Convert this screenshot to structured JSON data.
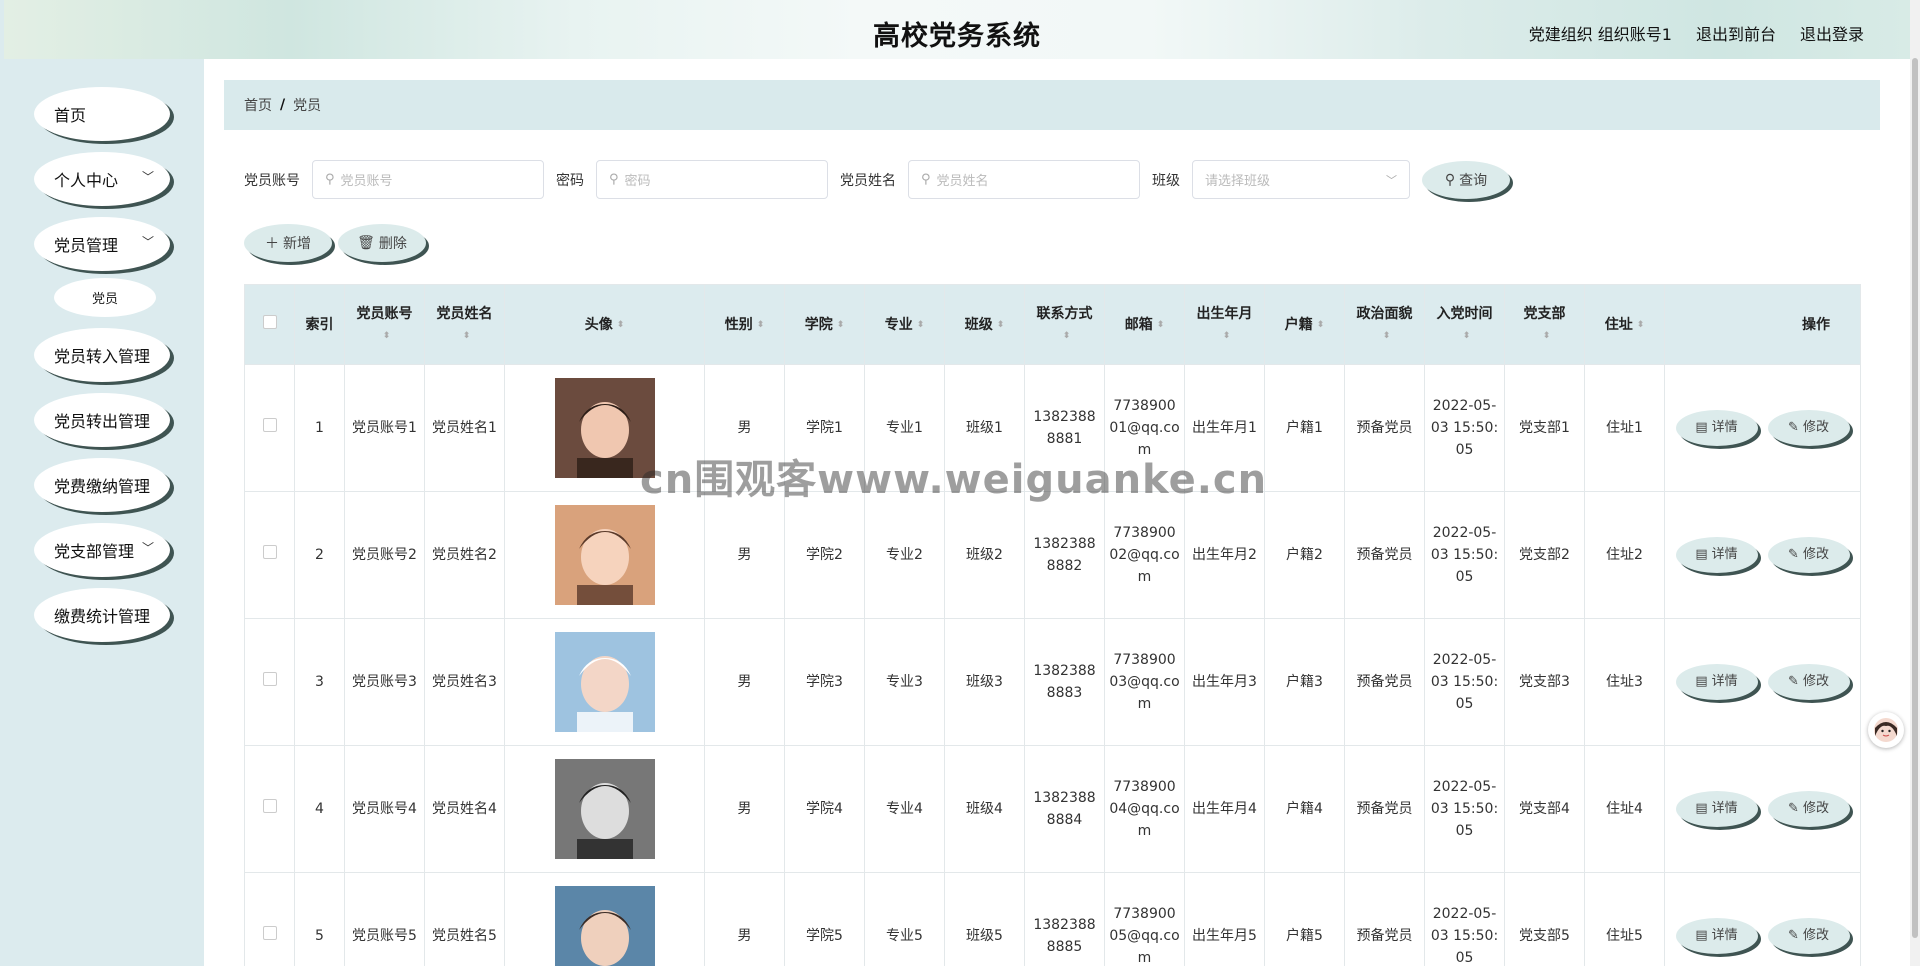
{
  "header": {
    "title": "高校党务系统",
    "user_label": "党建组织 组织账号1",
    "front_link": "退出到前台",
    "logout_link": "退出登录"
  },
  "sidebar": {
    "items": [
      {
        "label": "首页",
        "expandable": false
      },
      {
        "label": "个人中心",
        "expandable": true
      },
      {
        "label": "党员管理",
        "expandable": true
      },
      {
        "label": "党员",
        "sub": true
      },
      {
        "label": "党员转入管理",
        "expandable": false
      },
      {
        "label": "党员转出管理",
        "expandable": false
      },
      {
        "label": "党费缴纳管理",
        "expandable": false
      },
      {
        "label": "党支部管理",
        "expandable": true
      },
      {
        "label": "缴费统计管理",
        "expandable": false
      }
    ]
  },
  "breadcrumb": {
    "home": "首页",
    "sep": "/",
    "current": "党员"
  },
  "search": {
    "account_label": "党员账号",
    "account_placeholder": "党员账号",
    "password_label": "密码",
    "password_placeholder": "密码",
    "name_label": "党员姓名",
    "name_placeholder": "党员姓名",
    "class_label": "班级",
    "class_placeholder": "请选择班级",
    "query_button": "查询"
  },
  "toolbar": {
    "add_button": "新增",
    "delete_button": "删除"
  },
  "table": {
    "headers": [
      "索引",
      "党员账号",
      "党员姓名",
      "头像",
      "性别",
      "学院",
      "专业",
      "班级",
      "联系方式",
      "邮箱",
      "出生年月",
      "户籍",
      "政治面貌",
      "入党时间",
      "党支部",
      "住址",
      "操作"
    ],
    "detail_button": "详情",
    "edit_button": "修改",
    "rows": [
      [
        "1",
        "党员账号1",
        "党员姓名1",
        "avatar-1",
        "男",
        "学院1",
        "专业1",
        "班级1",
        "13823888881",
        "773890001@qq.com",
        "出生年月1",
        "户籍1",
        "预备党员",
        "2022-05-03 15:50:05",
        "党支部1",
        "住址1"
      ],
      [
        "2",
        "党员账号2",
        "党员姓名2",
        "avatar-2",
        "男",
        "学院2",
        "专业2",
        "班级2",
        "13823888882",
        "773890002@qq.com",
        "出生年月2",
        "户籍2",
        "预备党员",
        "2022-05-03 15:50:05",
        "党支部2",
        "住址2"
      ],
      [
        "3",
        "党员账号3",
        "党员姓名3",
        "avatar-3",
        "男",
        "学院3",
        "专业3",
        "班级3",
        "13823888883",
        "773890003@qq.com",
        "出生年月3",
        "户籍3",
        "预备党员",
        "2022-05-03 15:50:05",
        "党支部3",
        "住址3"
      ],
      [
        "4",
        "党员账号4",
        "党员姓名4",
        "avatar-4",
        "男",
        "学院4",
        "专业4",
        "班级4",
        "13823888884",
        "773890004@qq.com",
        "出生年月4",
        "户籍4",
        "预备党员",
        "2022-05-03 15:50:05",
        "党支部4",
        "住址4"
      ],
      [
        "5",
        "党员账号5",
        "党员姓名5",
        "avatar-5",
        "男",
        "学院5",
        "专业5",
        "班级5",
        "13823888885",
        "773890005@qq.com",
        "出生年月5",
        "户籍5",
        "预备党员",
        "2022-05-03 15:50:05",
        "党支部5",
        "住址5"
      ]
    ]
  },
  "watermark": "cn围观客www.weiguanke.cn",
  "colors": {
    "accent": "#dcebee",
    "shadow": "#3f5452"
  }
}
